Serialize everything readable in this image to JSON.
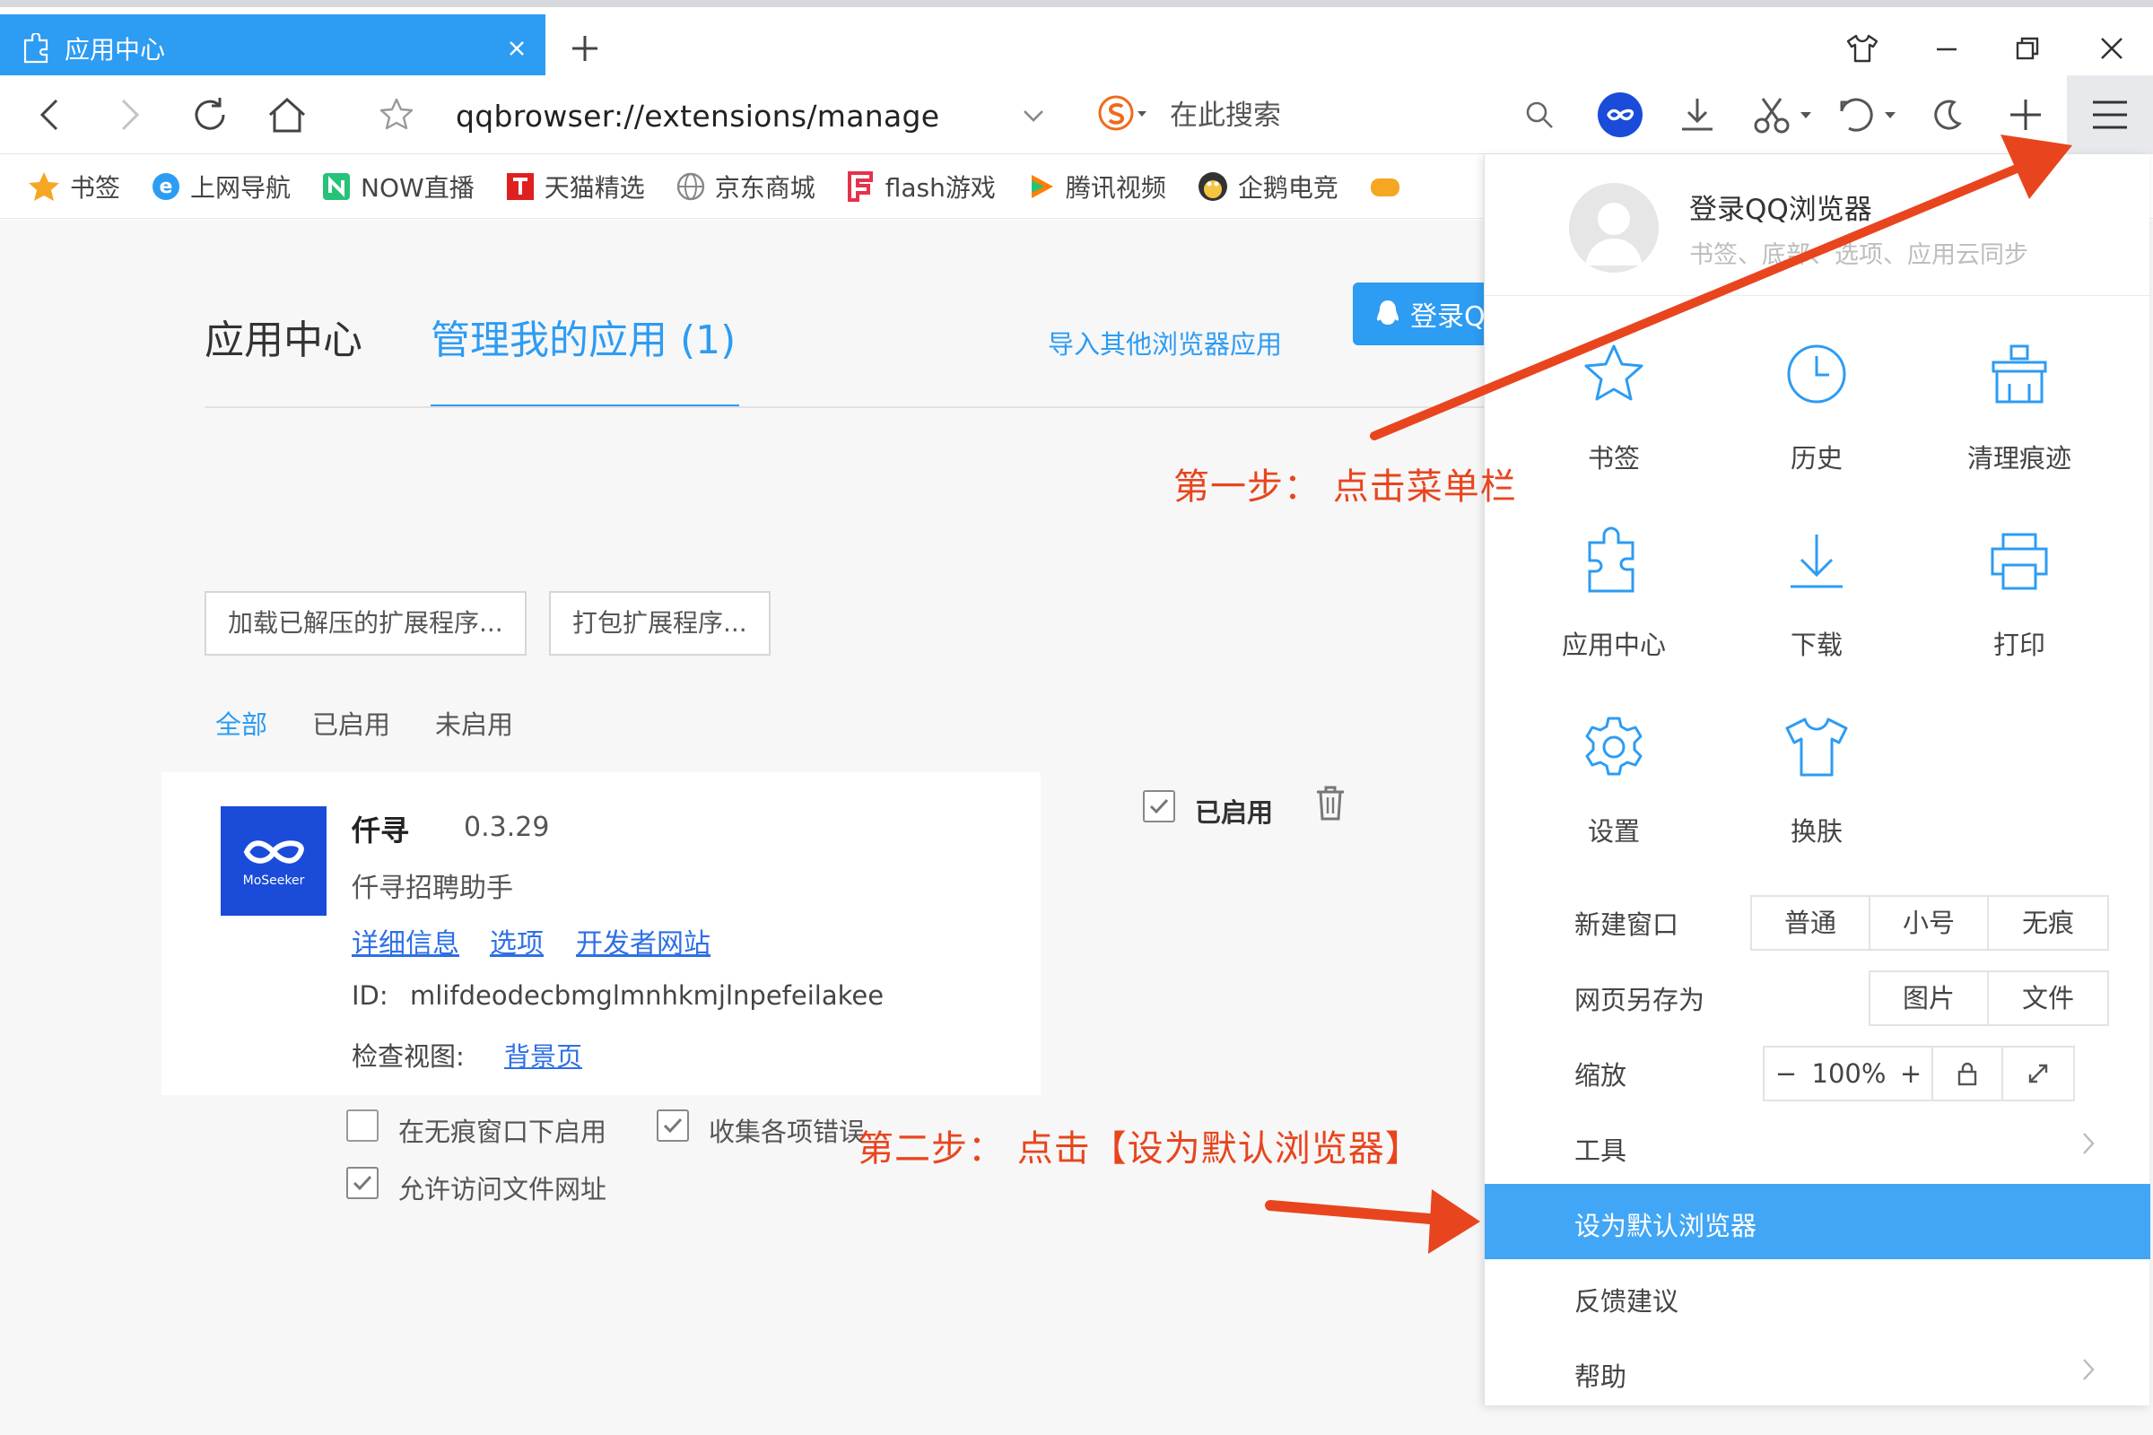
{
  "window": {
    "tab_title": "应用中心"
  },
  "navbar": {
    "url": "qqbrowser://extensions/manage",
    "search_placeholder": "在此搜索"
  },
  "bookmarks": [
    {
      "label": "书签",
      "icon": "star-icon",
      "color": "#f5a623"
    },
    {
      "label": "上网导航",
      "icon": "ie-icon",
      "color": "#2d9cf3"
    },
    {
      "label": "NOW直播",
      "icon": "now-icon",
      "color": "#27c27a"
    },
    {
      "label": "天猫精选",
      "icon": "tmall-icon",
      "color": "#e02020"
    },
    {
      "label": "京东商城",
      "icon": "globe-icon",
      "color": "#888888"
    },
    {
      "label": "flash游戏",
      "icon": "flash-game-icon",
      "color": "#e6324b"
    },
    {
      "label": "腾讯视频",
      "icon": "video-icon",
      "color": "#ff7f00"
    },
    {
      "label": "企鹅电竞",
      "icon": "penguin-icon",
      "color": "#333333"
    }
  ],
  "page": {
    "tab_app_center": "应用中心",
    "tab_manage": "管理我的应用 (1)",
    "import_link": "导入其他浏览器应用",
    "login_button": "登录Q",
    "load_unpacked": "加载已解压的扩展程序...",
    "pack_extension": "打包扩展程序...",
    "filters": [
      "全部",
      "已启用",
      "未启用"
    ]
  },
  "extension": {
    "logo_text": "MoSeeker",
    "name": "仟寻",
    "version": "0.3.29",
    "description": "仟寻招聘助手",
    "links": [
      "详细信息",
      "选项",
      "开发者网站"
    ],
    "id_label": "ID:",
    "id": "mlifdeodecbmglmnhkmjlnpefeilakee",
    "view_label": "检查视图:",
    "view_link": "背景页",
    "enabled_label": "已启用",
    "incognito_label": "在无痕窗口下启用",
    "errors_label": "收集各项错误",
    "file_access_label": "允许访问文件网址"
  },
  "menu": {
    "login_title": "登录QQ浏览器",
    "login_sub": "书签、底部、选项、应用云同步",
    "grid": [
      {
        "label": "书签",
        "icon": "star-icon"
      },
      {
        "label": "历史",
        "icon": "clock-icon"
      },
      {
        "label": "清理痕迹",
        "icon": "clean-icon"
      },
      {
        "label": "应用中心",
        "icon": "puzzle-icon"
      },
      {
        "label": "下载",
        "icon": "download-icon"
      },
      {
        "label": "打印",
        "icon": "printer-icon"
      },
      {
        "label": "设置",
        "icon": "gear-icon"
      },
      {
        "label": "换肤",
        "icon": "shirt-icon"
      }
    ],
    "new_window": {
      "label": "新建窗口",
      "options": [
        "普通",
        "小号",
        "无痕"
      ]
    },
    "save_as": {
      "label": "网页另存为",
      "options": [
        "图片",
        "文件"
      ]
    },
    "zoom": {
      "label": "缩放",
      "minus": "−",
      "value": "100%",
      "plus": "+"
    },
    "tools": "工具",
    "set_default": "设为默认浏览器",
    "feedback": "反馈建议",
    "help": "帮助"
  },
  "annotations": {
    "step1": "第一步：  点击菜单栏",
    "step2": "第二步：  点击【设为默认浏览器】",
    "color": "#e8451e"
  }
}
